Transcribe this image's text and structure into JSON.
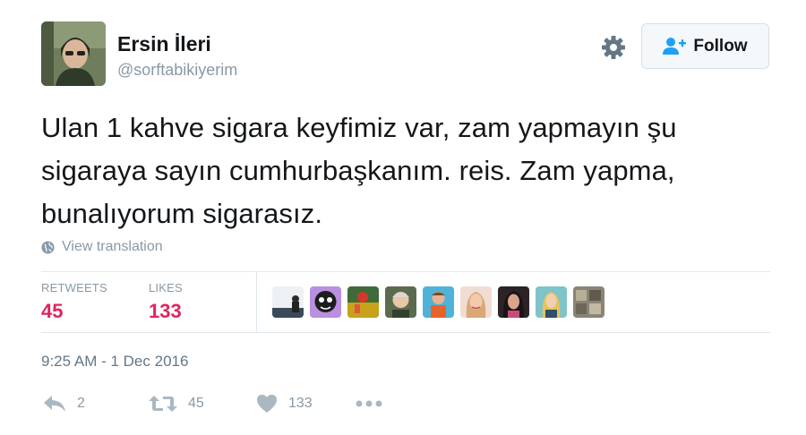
{
  "user": {
    "name": "Ersin İleri",
    "handle": "@sorftabikiyerim"
  },
  "follow_button": {
    "label": "Follow"
  },
  "tweet": {
    "text": "Ulan 1 kahve sigara keyfimiz var, zam yapmayın şu sigaraya sayın cumhurbaşkanım. reis. Zam yapma, bunalıyorum sigarasız.",
    "translation_link": "View translation",
    "timestamp": "9:25 AM - 1 Dec 2016"
  },
  "stats": {
    "retweets_label": "RETWEETS",
    "retweets_value": "45",
    "likes_label": "LIKES",
    "likes_value": "133"
  },
  "actions": {
    "reply_count": "2",
    "retweet_count": "45",
    "like_count": "133"
  },
  "colors": {
    "accent_pink": "#e0245e",
    "muted_text": "#8899a6",
    "follow_icon": "#1da1f2"
  },
  "icons": {
    "settings": "gear-icon",
    "follow": "add-user-icon",
    "translate": "globe-icon",
    "reply": "reply-icon",
    "retweet": "retweet-icon",
    "like": "heart-icon",
    "more": "more-dots-icon"
  },
  "likers_count_shown": 9
}
